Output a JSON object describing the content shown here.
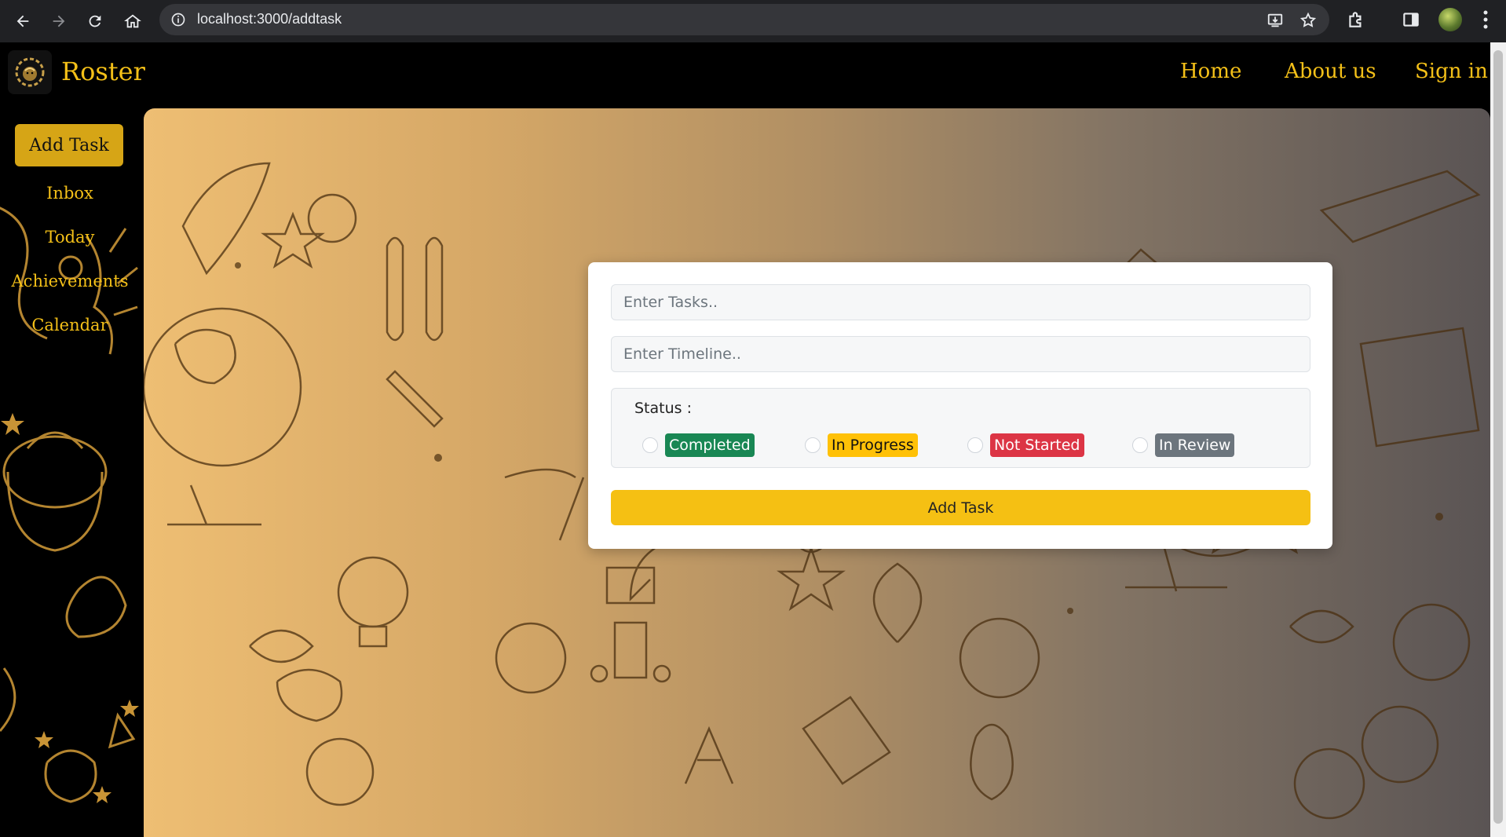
{
  "browser": {
    "url": "localhost:3000/addtask"
  },
  "header": {
    "brand": "Roster",
    "nav": [
      {
        "label": "Home"
      },
      {
        "label": "About us"
      },
      {
        "label": "Sign in"
      }
    ]
  },
  "sidebar": {
    "add_task_label": "Add Task",
    "items": [
      {
        "label": "Inbox"
      },
      {
        "label": "Today"
      },
      {
        "label": "Achievements"
      },
      {
        "label": "Calendar"
      }
    ]
  },
  "form": {
    "task_placeholder": "Enter Tasks..",
    "timeline_placeholder": "Enter Timeline..",
    "status_label": "Status :",
    "statuses": [
      {
        "label": "Completed",
        "color": "#198754"
      },
      {
        "label": "In Progress",
        "color": "#ffc107"
      },
      {
        "label": "Not Started",
        "color": "#dc3545"
      },
      {
        "label": "In Review",
        "color": "#6c757d"
      }
    ],
    "submit_label": "Add Task"
  },
  "colors": {
    "accent": "#f4c018",
    "sidebar_button": "#d6a516",
    "chrome": "#202124"
  }
}
